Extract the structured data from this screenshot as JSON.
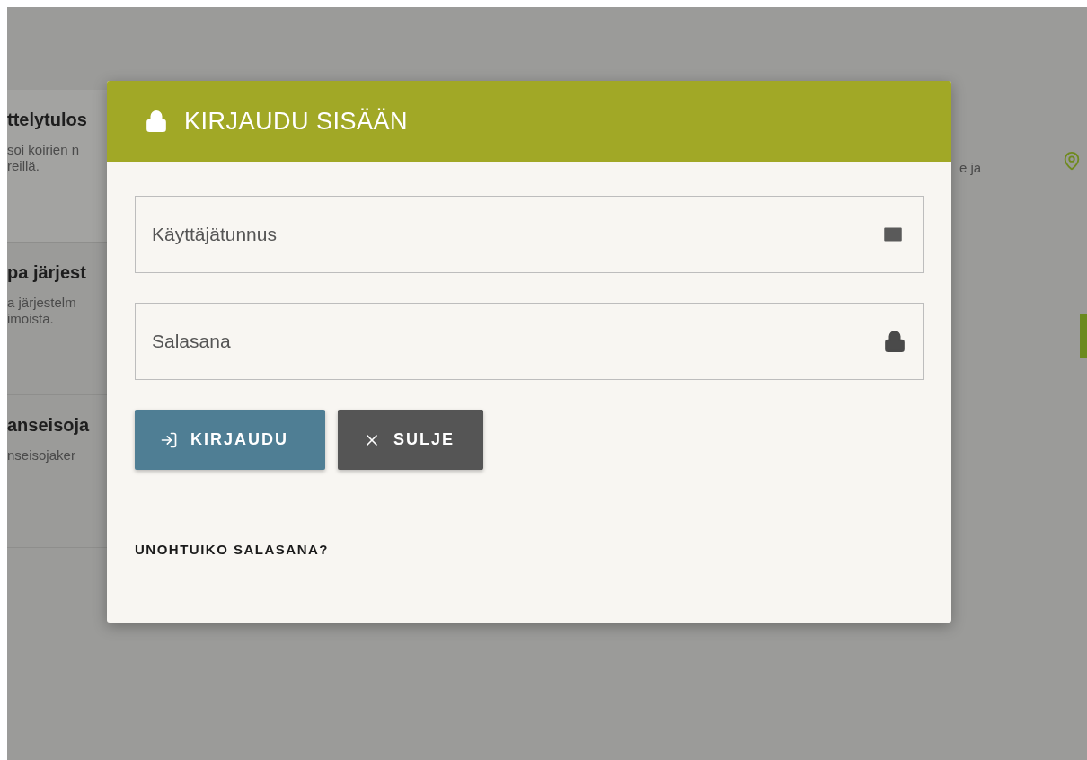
{
  "background": {
    "sections": [
      {
        "title": "ttelytulos",
        "lines": [
          "soi koirien n",
          "reillä."
        ]
      },
      {
        "title": "pa järjest",
        "lines": [
          "a järjestelm",
          "imoista."
        ]
      },
      {
        "title": "anseisoja",
        "lines": [
          "nseisojaker"
        ]
      }
    ],
    "right_text": "e ja"
  },
  "dialog": {
    "title": "KIRJAUDU SISÄÄN",
    "fields": [
      {
        "kind": "email",
        "placeholder": "Käyttäjätunnus"
      },
      {
        "kind": "password",
        "placeholder": "Salasana"
      }
    ],
    "buttons": [
      {
        "kind": "primary",
        "label": "KIRJAUDU"
      },
      {
        "kind": "close",
        "label": "SULJE"
      }
    ],
    "link": "UNOHTUIKO SALASANA?"
  }
}
